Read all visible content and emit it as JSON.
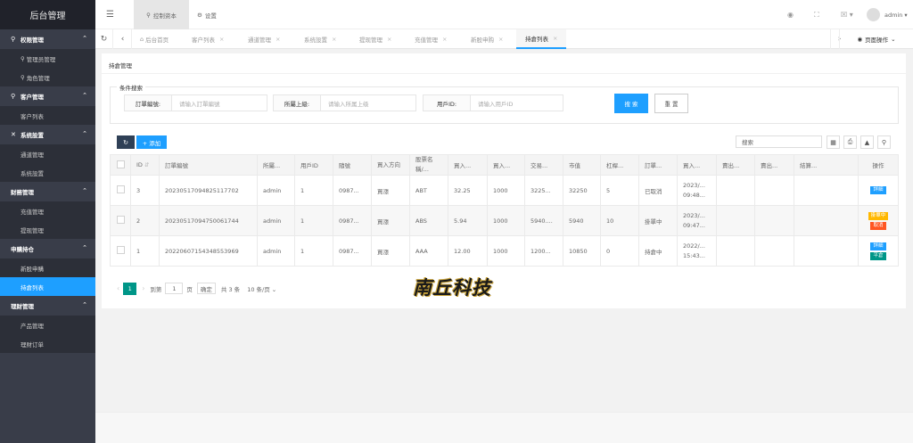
{
  "app": {
    "title": "后台管理"
  },
  "sidebar": {
    "groups": [
      {
        "label": "权限管理",
        "icon": "person-icon",
        "items": [
          {
            "label": "管理员管理"
          },
          {
            "label": "角色管理"
          }
        ]
      },
      {
        "label": "客户管理",
        "icon": "person-icon",
        "items": [
          {
            "label": "客户列表"
          }
        ]
      },
      {
        "label": "系统設置",
        "icon": "tools-icon",
        "items": [
          {
            "label": "通道管理"
          },
          {
            "label": "系统設置"
          }
        ]
      },
      {
        "label": "财務管理",
        "icon": "",
        "items": [
          {
            "label": "充值管理"
          },
          {
            "label": "提现管理"
          }
        ]
      },
      {
        "label": "申購持仓",
        "icon": "",
        "items": [
          {
            "label": "新股申購"
          },
          {
            "label": "持倉列表",
            "active": true
          }
        ]
      },
      {
        "label": "理财管理",
        "icon": "",
        "items": [
          {
            "label": "产品管理"
          },
          {
            "label": "理財订单"
          }
        ]
      }
    ]
  },
  "header": {
    "active_tab": "控制资本",
    "tab_settings": "设置",
    "user": "admin"
  },
  "tabs": [
    {
      "label": "后台首页"
    },
    {
      "label": "客户列表"
    },
    {
      "label": "通道管理"
    },
    {
      "label": "系统設置"
    },
    {
      "label": "提现管理"
    },
    {
      "label": "充值管理"
    },
    {
      "label": "新股申购"
    },
    {
      "label": "持倉列表",
      "active": true
    }
  ],
  "page_ops_label": "页面操作",
  "page_title": "持倉管理",
  "search": {
    "legend": "条件搜索",
    "fields": [
      {
        "label": "訂單編號:",
        "placeholder": "请输入訂單編號"
      },
      {
        "label": "所屬上級:",
        "placeholder": "请输入所属上级"
      },
      {
        "label": "用戶ID:",
        "placeholder": "请输入用戶ID"
      }
    ],
    "search_button": "搜 索",
    "reset_button": "重 置"
  },
  "toolbar": {
    "add_label": "+ 添加",
    "search_placeholder": "搜索"
  },
  "table": {
    "columns": [
      "ID",
      "訂單編號",
      "所屬...",
      "用戶ID",
      "隨號",
      "買入方向",
      "股票名稱/...",
      "買入...",
      "買入...",
      "交易...",
      "市值",
      "杠桿...",
      "訂單...",
      "買入...",
      "賣出...",
      "賣出...",
      "結算...",
      "操作"
    ],
    "rows": [
      {
        "id": "3",
        "order_no": "20230517094825117702",
        "parent": "admin",
        "user_id": "1",
        "account": "0987...",
        "direction": "買漲",
        "stock": "ABT",
        "buy_price": "32.25",
        "buy_qty": "1000",
        "trade": "3225...",
        "market_value": "32250",
        "leverage": "5",
        "status": "已取消",
        "buy_time": "2023/... 09:48...",
        "ops": [
          {
            "label": "詳細",
            "color": "#1e9fff"
          }
        ]
      },
      {
        "id": "2",
        "order_no": "20230517094750061744",
        "parent": "admin",
        "user_id": "1",
        "account": "0987...",
        "direction": "買漲",
        "stock": "ABS",
        "buy_price": "5.94",
        "buy_qty": "1000",
        "trade": "5940....",
        "market_value": "5940",
        "leverage": "10",
        "status": "掛單中",
        "buy_time": "2023/... 09:47...",
        "ops": [
          {
            "label": "掛單中",
            "color": "#ffb800"
          },
          {
            "label": "取消",
            "color": "#ff5722"
          }
        ]
      },
      {
        "id": "1",
        "order_no": "20220607154348553969",
        "parent": "admin",
        "user_id": "1",
        "account": "0987...",
        "direction": "買漲",
        "stock": "AAA",
        "buy_price": "12.00",
        "buy_qty": "1000",
        "trade": "1200...",
        "market_value": "10850",
        "leverage": "0",
        "status": "持倉中",
        "buy_time": "2022/... 15:43...",
        "ops": [
          {
            "label": "詳細",
            "color": "#1e9fff"
          },
          {
            "label": "平倉",
            "color": "#009688"
          }
        ]
      }
    ]
  },
  "pager": {
    "current": "1",
    "goto_label": "到第",
    "goto_value": "1",
    "page_unit": "页",
    "ok_label": "确定",
    "total": "共 3 条",
    "per_page": "10 条/页"
  },
  "watermark": "南丘科技"
}
